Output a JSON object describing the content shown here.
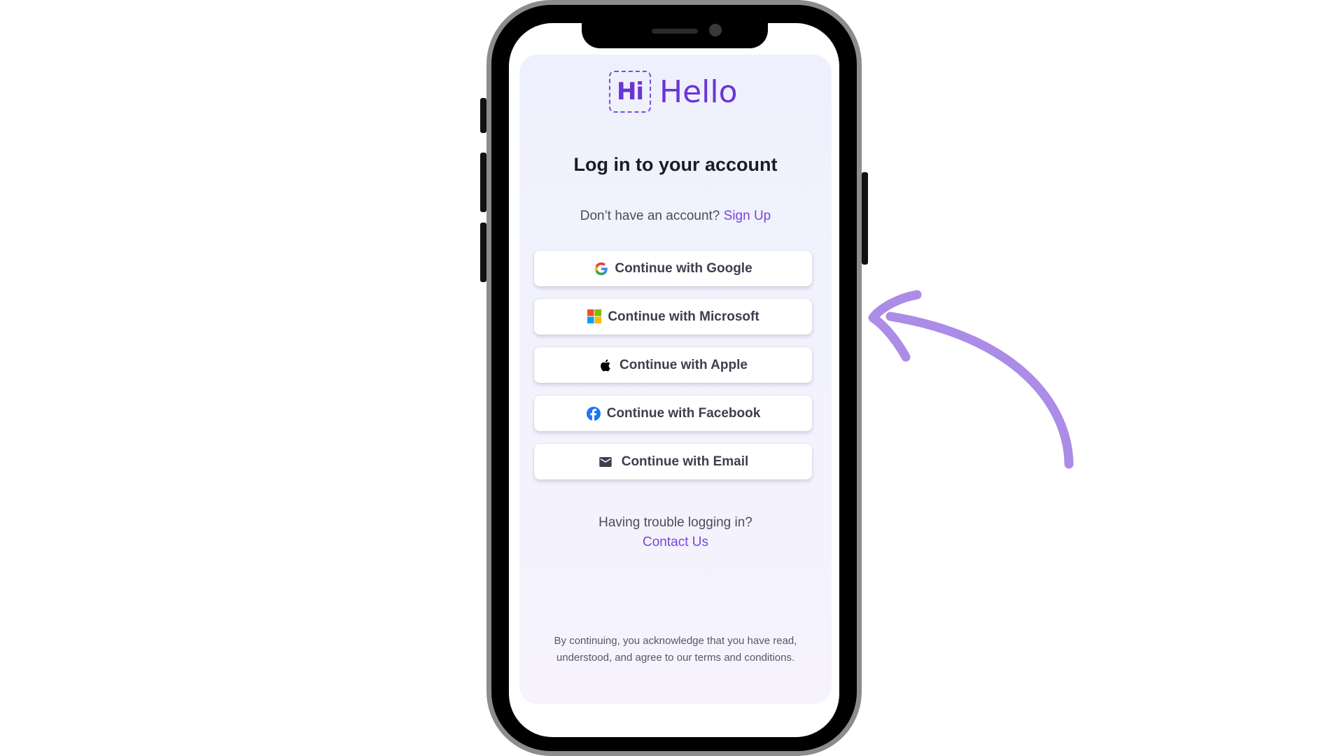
{
  "brand": {
    "logo_mark": "Hi",
    "logo_text": "Hello",
    "accent": "#6b35d4"
  },
  "page": {
    "title": "Log in to your account",
    "signup_prompt": "Don’t have an account?",
    "signup_link": "Sign Up"
  },
  "auth_buttons": [
    {
      "label": "Continue with Google",
      "icon": "google-icon"
    },
    {
      "label": "Continue with Microsoft",
      "icon": "microsoft-icon"
    },
    {
      "label": "Continue with Apple",
      "icon": "apple-icon"
    },
    {
      "label": "Continue with Facebook",
      "icon": "facebook-icon"
    },
    {
      "label": "Continue with Email",
      "icon": "mail-icon"
    }
  ],
  "help": {
    "text": "Having trouble logging in?",
    "link": "Contact Us"
  },
  "legal": {
    "line1": "By continuing, you acknowledge that you have read,",
    "line2": "understood, and agree to our terms and conditions."
  },
  "annotation": {
    "icon": "curved-arrow-icon",
    "color": "#ab8ce6"
  }
}
